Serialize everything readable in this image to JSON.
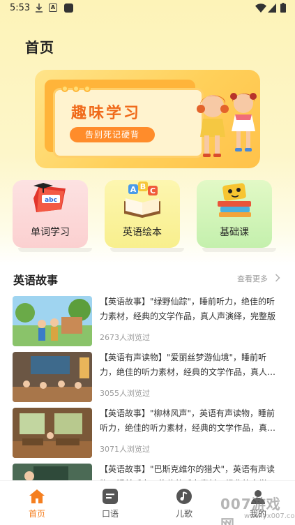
{
  "status_bar": {
    "time": "5:53",
    "icons": [
      "download-icon",
      "font-a-icon",
      "app-square-icon",
      "wifi-icon",
      "signal-icon",
      "battery-icon"
    ]
  },
  "page": {
    "title": "首页"
  },
  "banner": {
    "title": "趣味学习",
    "subtitle": "告别死记硬背",
    "accent_color": "#f06a1a"
  },
  "categories": [
    {
      "label": "单词学习",
      "icon": "abc-book-icon"
    },
    {
      "label": "英语绘本",
      "icon": "picture-book-icon"
    },
    {
      "label": "基础课",
      "icon": "cartoon-books-icon"
    }
  ],
  "section": {
    "title": "英语故事",
    "more": "查看更多"
  },
  "stories": [
    {
      "title": "【英语故事】\"绿野仙踪\"，睡前听力，绝佳的听力素材，经典的文学作品，真人声演绎，完整版",
      "views": "2673人浏览过"
    },
    {
      "title": "【英语有声读物】\"爱丽丝梦游仙境\"，睡前听力，绝佳的听力素材，经典的文学作品，真人声演绎",
      "views": "3055人浏览过"
    },
    {
      "title": "【英语故事】\"柳林风声\"，英语有声读物，睡前听力，绝佳的听力素材，经典的文学作品，真人声演绎",
      "views": "3071人浏览过"
    },
    {
      "title": "【英语故事】\"巴斯克维尔的猎犬\"，英语有声读物，睡前听力，绝佳的听力素材，经典的文学作品",
      "views": ""
    }
  ],
  "bottom_nav": [
    {
      "label": "首页",
      "icon": "home-icon",
      "active": true
    },
    {
      "label": "口语",
      "icon": "message-icon",
      "active": false
    },
    {
      "label": "儿歌",
      "icon": "music-icon",
      "active": false
    },
    {
      "label": "我的",
      "icon": "user-icon",
      "active": false
    }
  ],
  "watermark": {
    "big": "007游戏网",
    "small": "www.yx007.com"
  },
  "colors": {
    "accent": "#f57f20",
    "background": "#fdf3b8"
  }
}
